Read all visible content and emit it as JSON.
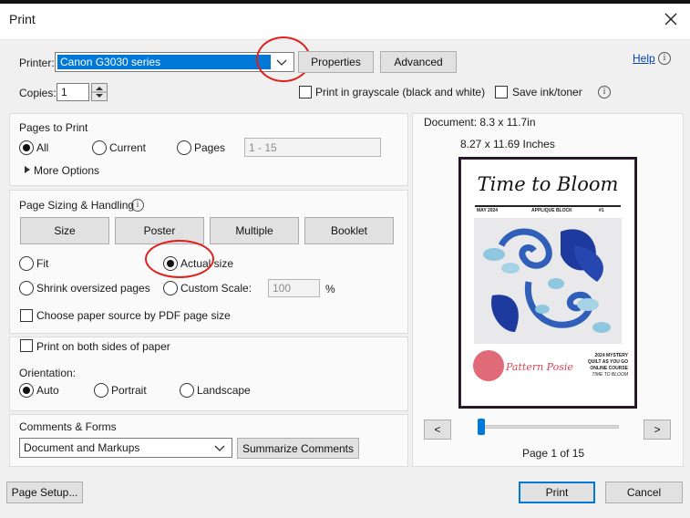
{
  "window": {
    "title": "Print"
  },
  "printer": {
    "label": "Printer:",
    "selected": "Canon G3030 series",
    "properties_label": "Properties",
    "advanced_label": "Advanced",
    "help_label": "Help"
  },
  "copies": {
    "label": "Copies:",
    "value": "1",
    "grayscale_label": "Print in grayscale (black and white)",
    "save_ink_label": "Save ink/toner"
  },
  "pages_to_print": {
    "heading": "Pages to Print",
    "all_label": "All",
    "current_label": "Current",
    "pages_label": "Pages",
    "pages_placeholder": "1 - 15",
    "more_options_label": "More Options"
  },
  "page_sizing": {
    "heading": "Page Sizing & Handling",
    "size_label": "Size",
    "poster_label": "Poster",
    "multiple_label": "Multiple",
    "booklet_label": "Booklet",
    "fit_label": "Fit",
    "actual_size_label": "Actual size",
    "shrink_label": "Shrink oversized pages",
    "custom_scale_label": "Custom Scale:",
    "custom_scale_value": "100",
    "percent_label": "%",
    "paper_source_label": "Choose paper source by PDF page size"
  },
  "duplex": {
    "both_sides_label": "Print on both sides of paper"
  },
  "orientation": {
    "label": "Orientation:",
    "auto_label": "Auto",
    "portrait_label": "Portrait",
    "landscape_label": "Landscape"
  },
  "comments": {
    "heading": "Comments & Forms",
    "selected": "Document and Markups",
    "summarize_label": "Summarize Comments"
  },
  "preview": {
    "document_size": "Document: 8.3 x 11.7in",
    "paper_size": "8.27 x 11.69 Inches",
    "page_indicator": "Page 1 of 15",
    "prev_label": "<",
    "next_label": ">",
    "slider_position": 0.0
  },
  "thumbnail": {
    "title": "Time to Bloom",
    "meta_left": "MAY 2024",
    "meta_mid": "APPLIQUE BLOCK",
    "meta_right": "#1",
    "brand": "Pattern Posie",
    "course_line1": "2024 MYSTERY",
    "course_line2": "QUILT AS YOU GO",
    "course_line3": "ONLINE COURSE",
    "course_line4": "TIME TO BLOOM"
  },
  "footer": {
    "page_setup_label": "Page Setup...",
    "print_label": "Print",
    "cancel_label": "Cancel"
  },
  "colors": {
    "accent": "#0078d7",
    "highlight": "#e0201b",
    "selection": "#0078d7"
  }
}
